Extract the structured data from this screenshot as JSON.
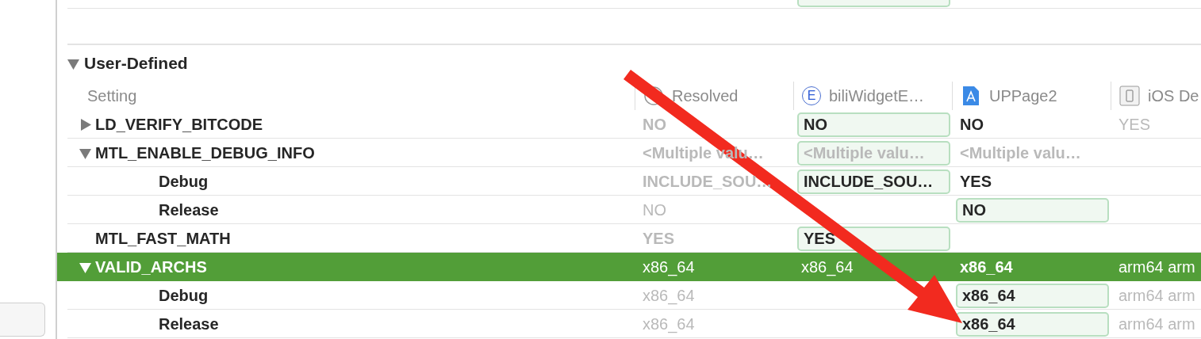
{
  "section": {
    "title": "User-Defined",
    "expanded": true
  },
  "columns": [
    {
      "label": "Setting",
      "kind": "setting"
    },
    {
      "label": "Resolved",
      "kind": "resolved"
    },
    {
      "label": "biliWidgetE…",
      "kind": "extension",
      "icon_letter": "E"
    },
    {
      "label": "UPPage2",
      "kind": "app"
    },
    {
      "label": "iOS De",
      "kind": "device"
    }
  ],
  "rows": [
    {
      "name": "LD_VERIFY_BITCODE",
      "expanded": false,
      "selected": false,
      "values": {
        "column_2": {
          "text": "NO",
          "bold": true,
          "dim": true,
          "boxed": false
        },
        "column_3": {
          "text": "NO",
          "bold": true,
          "dim": false,
          "boxed": true
        },
        "column_4": {
          "text": "NO",
          "bold": true,
          "dim": false,
          "boxed": false
        },
        "column_5": {
          "text": "YES",
          "bold": false,
          "dim": true,
          "boxed": false
        }
      }
    },
    {
      "name": "MTL_ENABLE_DEBUG_INFO",
      "expanded": true,
      "selected": false,
      "values": {
        "column_2": {
          "text": "<Multiple valu…",
          "bold": true,
          "dim": true,
          "boxed": false
        },
        "column_3": {
          "text": "<Multiple valu…",
          "bold": true,
          "dim": true,
          "boxed": true
        },
        "column_4": {
          "text": "<Multiple valu…",
          "bold": true,
          "dim": true,
          "boxed": false
        }
      },
      "children": [
        {
          "name": "Debug",
          "selected": false,
          "values": {
            "column_2": {
              "text": "INCLUDE_SOU…",
              "bold": true,
              "dim": true,
              "boxed": false
            },
            "column_3": {
              "text": "INCLUDE_SOU…",
              "bold": true,
              "dim": false,
              "boxed": true
            },
            "column_4": {
              "text": "YES",
              "bold": true,
              "dim": false,
              "boxed": false
            }
          }
        },
        {
          "name": "Release",
          "selected": false,
          "values": {
            "column_2": {
              "text": "NO",
              "bold": false,
              "dim": true,
              "boxed": false
            },
            "column_4": {
              "text": "NO",
              "bold": true,
              "dim": false,
              "boxed": true
            }
          }
        }
      ]
    },
    {
      "name": "MTL_FAST_MATH",
      "selected": false,
      "values": {
        "column_2": {
          "text": "YES",
          "bold": true,
          "dim": true,
          "boxed": false
        },
        "column_3": {
          "text": "YES",
          "bold": true,
          "dim": false,
          "boxed": true
        }
      }
    },
    {
      "name": "VALID_ARCHS",
      "expanded": true,
      "selected": true,
      "values": {
        "column_2": {
          "text": "x86_64",
          "bold": false,
          "boxed": false
        },
        "column_3": {
          "text": "x86_64",
          "bold": false,
          "boxed": false
        },
        "column_4": {
          "text": "x86_64",
          "bold": true,
          "boxed": false
        },
        "column_5": {
          "text": "arm64 arm",
          "bold": false,
          "boxed": false
        }
      },
      "children": [
        {
          "name": "Debug",
          "selected": false,
          "values": {
            "column_2": {
              "text": "x86_64",
              "bold": false,
              "dim": true,
              "boxed": false
            },
            "column_4": {
              "text": "x86_64",
              "bold": true,
              "dim": false,
              "boxed": true
            },
            "column_5": {
              "text": "arm64 arm",
              "bold": false,
              "dim": true,
              "boxed": false
            }
          }
        },
        {
          "name": "Release",
          "selected": false,
          "values": {
            "column_2": {
              "text": "x86_64",
              "bold": false,
              "dim": true,
              "boxed": false
            },
            "column_4": {
              "text": "x86_64",
              "bold": true,
              "dim": false,
              "boxed": true
            },
            "column_5": {
              "text": "arm64 arm",
              "bold": false,
              "dim": true,
              "boxed": false
            }
          }
        }
      ]
    }
  ]
}
